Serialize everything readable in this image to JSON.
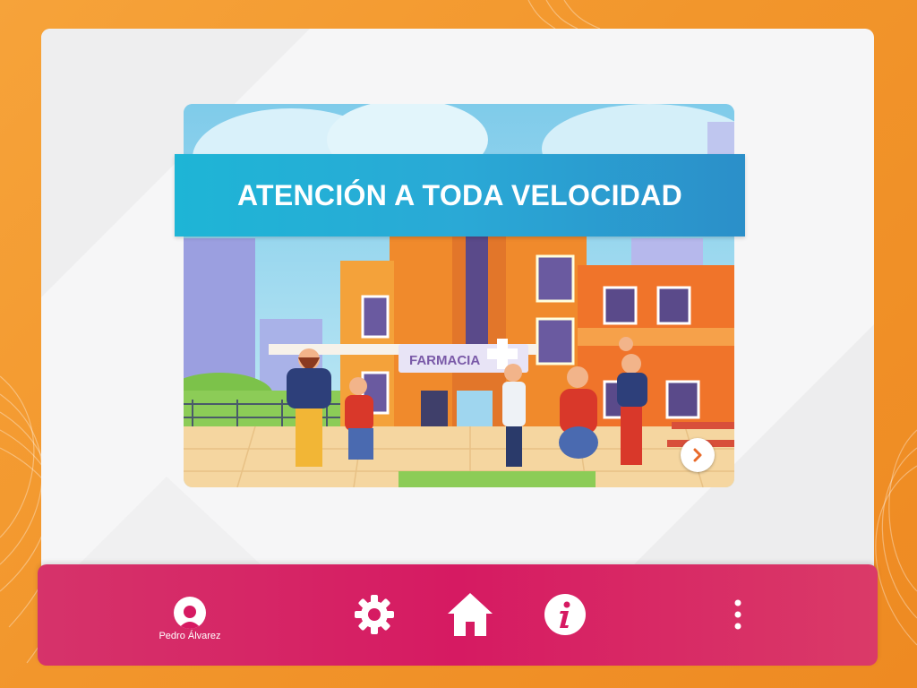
{
  "colors": {
    "background_orange": "#f2962c",
    "panel": "#f6f6f7",
    "banner_blue": "#2aa9d6",
    "bottom_bar": "#d61a62"
  },
  "slide": {
    "title": "ATENCIÓN A TODA VELOCIDAD",
    "sign_text": "FARMACIA",
    "next_icon": "chevron-right-icon"
  },
  "bottom_bar": {
    "user_name": "Pedro Álvarez",
    "user_icon": "user-avatar-icon",
    "settings_icon": "gear-icon",
    "home_icon": "home-icon",
    "info_icon": "info-icon",
    "menu_icon": "more-vertical-icon"
  }
}
